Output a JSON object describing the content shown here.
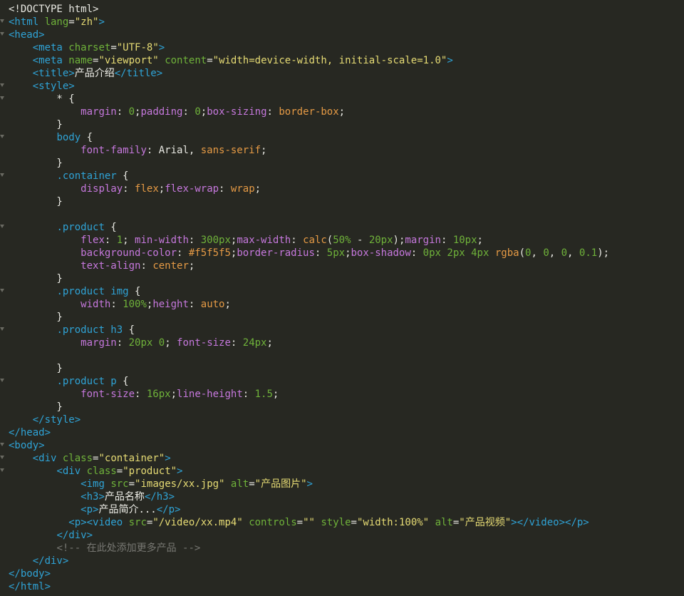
{
  "editor": {
    "colors": {
      "background": "#272822",
      "tag": "#2fa3d6",
      "attribute": "#6fb23a",
      "string": "#e6db74",
      "property": "#c678dd",
      "number": "#6fb23a",
      "value": "#e59a45",
      "comment": "#777772"
    },
    "lines": [
      {
        "fold": false,
        "tokens": [
          [
            "doctype",
            "<!DOCTYPE html>"
          ]
        ]
      },
      {
        "fold": true,
        "tokens": [
          [
            "tag",
            "<html "
          ],
          [
            "attr",
            "lang"
          ],
          [
            "punc",
            "="
          ],
          [
            "str",
            "\"zh\""
          ],
          [
            "tag",
            ">"
          ]
        ]
      },
      {
        "fold": true,
        "tokens": [
          [
            "tag",
            "<head>"
          ]
        ]
      },
      {
        "fold": false,
        "tokens": [
          [
            "punc",
            "    "
          ],
          [
            "tag",
            "<meta "
          ],
          [
            "attr",
            "charset"
          ],
          [
            "punc",
            "="
          ],
          [
            "str",
            "\"UTF-8\""
          ],
          [
            "tag",
            ">"
          ]
        ]
      },
      {
        "fold": false,
        "tokens": [
          [
            "punc",
            "    "
          ],
          [
            "tag",
            "<meta "
          ],
          [
            "attr",
            "name"
          ],
          [
            "punc",
            "="
          ],
          [
            "str",
            "\"viewport\""
          ],
          [
            "punc",
            " "
          ],
          [
            "attr",
            "content"
          ],
          [
            "punc",
            "="
          ],
          [
            "str",
            "\"width=device-width, initial-scale=1.0\""
          ],
          [
            "tag",
            ">"
          ]
        ]
      },
      {
        "fold": false,
        "tokens": [
          [
            "punc",
            "    "
          ],
          [
            "tag",
            "<title>"
          ],
          [
            "text",
            "产品介绍"
          ],
          [
            "tag",
            "</title>"
          ]
        ]
      },
      {
        "fold": true,
        "tokens": [
          [
            "punc",
            "    "
          ],
          [
            "tag",
            "<style>"
          ]
        ]
      },
      {
        "fold": true,
        "tokens": [
          [
            "punc",
            "        * {"
          ]
        ]
      },
      {
        "fold": false,
        "tokens": [
          [
            "punc",
            "            "
          ],
          [
            "prop",
            "margin"
          ],
          [
            "punc",
            ": "
          ],
          [
            "num",
            "0"
          ],
          [
            "punc",
            ";"
          ],
          [
            "prop",
            "padding"
          ],
          [
            "punc",
            ": "
          ],
          [
            "num",
            "0"
          ],
          [
            "punc",
            ";"
          ],
          [
            "prop",
            "box-sizing"
          ],
          [
            "punc",
            ": "
          ],
          [
            "val",
            "border-box"
          ],
          [
            "punc",
            ";"
          ]
        ]
      },
      {
        "fold": false,
        "tokens": [
          [
            "punc",
            "        }"
          ]
        ]
      },
      {
        "fold": true,
        "tokens": [
          [
            "punc",
            "        "
          ],
          [
            "sel",
            "body"
          ],
          [
            "punc",
            " {"
          ]
        ]
      },
      {
        "fold": false,
        "tokens": [
          [
            "punc",
            "            "
          ],
          [
            "prop",
            "font-family"
          ],
          [
            "punc",
            ": Arial, "
          ],
          [
            "val",
            "sans-serif"
          ],
          [
            "punc",
            ";"
          ]
        ]
      },
      {
        "fold": false,
        "tokens": [
          [
            "punc",
            "        }"
          ]
        ]
      },
      {
        "fold": true,
        "tokens": [
          [
            "punc",
            "        "
          ],
          [
            "sel",
            ".container"
          ],
          [
            "punc",
            " {"
          ]
        ]
      },
      {
        "fold": false,
        "tokens": [
          [
            "punc",
            "            "
          ],
          [
            "prop",
            "display"
          ],
          [
            "punc",
            ": "
          ],
          [
            "val",
            "flex"
          ],
          [
            "punc",
            ";"
          ],
          [
            "prop",
            "flex-wrap"
          ],
          [
            "punc",
            ": "
          ],
          [
            "val",
            "wrap"
          ],
          [
            "punc",
            ";"
          ]
        ]
      },
      {
        "fold": false,
        "tokens": [
          [
            "punc",
            "        }"
          ]
        ]
      },
      {
        "fold": false,
        "tokens": [
          [
            "punc",
            ""
          ]
        ]
      },
      {
        "fold": true,
        "tokens": [
          [
            "punc",
            "        "
          ],
          [
            "sel",
            ".product"
          ],
          [
            "punc",
            " {"
          ]
        ]
      },
      {
        "fold": false,
        "tokens": [
          [
            "punc",
            "            "
          ],
          [
            "prop",
            "flex"
          ],
          [
            "punc",
            ": "
          ],
          [
            "num",
            "1"
          ],
          [
            "punc",
            "; "
          ],
          [
            "prop",
            "min-width"
          ],
          [
            "punc",
            ": "
          ],
          [
            "num",
            "300px"
          ],
          [
            "punc",
            ";"
          ],
          [
            "prop",
            "max-width"
          ],
          [
            "punc",
            ": "
          ],
          [
            "val",
            "calc"
          ],
          [
            "punc",
            "("
          ],
          [
            "num",
            "50%"
          ],
          [
            "punc",
            " - "
          ],
          [
            "num",
            "20px"
          ],
          [
            "punc",
            ");"
          ],
          [
            "prop",
            "margin"
          ],
          [
            "punc",
            ": "
          ],
          [
            "num",
            "10px"
          ],
          [
            "punc",
            ";"
          ]
        ]
      },
      {
        "fold": false,
        "tokens": [
          [
            "punc",
            "            "
          ],
          [
            "prop",
            "background-color"
          ],
          [
            "punc",
            ": "
          ],
          [
            "val",
            "#f5f5f5"
          ],
          [
            "punc",
            ";"
          ],
          [
            "prop",
            "border-radius"
          ],
          [
            "punc",
            ": "
          ],
          [
            "num",
            "5px"
          ],
          [
            "punc",
            ";"
          ],
          [
            "prop",
            "box-shadow"
          ],
          [
            "punc",
            ": "
          ],
          [
            "num",
            "0px"
          ],
          [
            "punc",
            " "
          ],
          [
            "num",
            "2px"
          ],
          [
            "punc",
            " "
          ],
          [
            "num",
            "4px"
          ],
          [
            "punc",
            " "
          ],
          [
            "val",
            "rgba"
          ],
          [
            "punc",
            "("
          ],
          [
            "num",
            "0"
          ],
          [
            "punc",
            ", "
          ],
          [
            "num",
            "0"
          ],
          [
            "punc",
            ", "
          ],
          [
            "num",
            "0"
          ],
          [
            "punc",
            ", "
          ],
          [
            "num",
            "0.1"
          ],
          [
            "punc",
            ");"
          ]
        ]
      },
      {
        "fold": false,
        "tokens": [
          [
            "punc",
            "            "
          ],
          [
            "prop",
            "text-align"
          ],
          [
            "punc",
            ": "
          ],
          [
            "val",
            "center"
          ],
          [
            "punc",
            ";"
          ]
        ]
      },
      {
        "fold": false,
        "tokens": [
          [
            "punc",
            "        }"
          ]
        ]
      },
      {
        "fold": true,
        "tokens": [
          [
            "punc",
            "        "
          ],
          [
            "sel",
            ".product img"
          ],
          [
            "punc",
            " {"
          ]
        ]
      },
      {
        "fold": false,
        "tokens": [
          [
            "punc",
            "            "
          ],
          [
            "prop",
            "width"
          ],
          [
            "punc",
            ": "
          ],
          [
            "num",
            "100%"
          ],
          [
            "punc",
            ";"
          ],
          [
            "prop",
            "height"
          ],
          [
            "punc",
            ": "
          ],
          [
            "val",
            "auto"
          ],
          [
            "punc",
            ";"
          ]
        ]
      },
      {
        "fold": false,
        "tokens": [
          [
            "punc",
            "        }"
          ]
        ]
      },
      {
        "fold": true,
        "tokens": [
          [
            "punc",
            "        "
          ],
          [
            "sel",
            ".product h3"
          ],
          [
            "punc",
            " {"
          ]
        ]
      },
      {
        "fold": false,
        "tokens": [
          [
            "punc",
            "            "
          ],
          [
            "prop",
            "margin"
          ],
          [
            "punc",
            ": "
          ],
          [
            "num",
            "20px"
          ],
          [
            "punc",
            " "
          ],
          [
            "num",
            "0"
          ],
          [
            "punc",
            "; "
          ],
          [
            "prop",
            "font-size"
          ],
          [
            "punc",
            ": "
          ],
          [
            "num",
            "24px"
          ],
          [
            "punc",
            ";"
          ]
        ]
      },
      {
        "fold": false,
        "tokens": [
          [
            "punc",
            ""
          ]
        ]
      },
      {
        "fold": false,
        "tokens": [
          [
            "punc",
            "        }"
          ]
        ]
      },
      {
        "fold": true,
        "tokens": [
          [
            "punc",
            "        "
          ],
          [
            "sel",
            ".product p"
          ],
          [
            "punc",
            " {"
          ]
        ]
      },
      {
        "fold": false,
        "tokens": [
          [
            "punc",
            "            "
          ],
          [
            "prop",
            "font-size"
          ],
          [
            "punc",
            ": "
          ],
          [
            "num",
            "16px"
          ],
          [
            "punc",
            ";"
          ],
          [
            "prop",
            "line-height"
          ],
          [
            "punc",
            ": "
          ],
          [
            "num",
            "1.5"
          ],
          [
            "punc",
            ";"
          ]
        ]
      },
      {
        "fold": false,
        "tokens": [
          [
            "punc",
            "        }"
          ]
        ]
      },
      {
        "fold": false,
        "tokens": [
          [
            "punc",
            "    "
          ],
          [
            "tag",
            "</style>"
          ]
        ]
      },
      {
        "fold": false,
        "tokens": [
          [
            "tag",
            "</head>"
          ]
        ]
      },
      {
        "fold": true,
        "tokens": [
          [
            "tag",
            "<body>"
          ]
        ]
      },
      {
        "fold": true,
        "tokens": [
          [
            "punc",
            "    "
          ],
          [
            "tag",
            "<div "
          ],
          [
            "attr",
            "class"
          ],
          [
            "punc",
            "="
          ],
          [
            "str",
            "\"container\""
          ],
          [
            "tag",
            ">"
          ]
        ]
      },
      {
        "fold": true,
        "tokens": [
          [
            "punc",
            "        "
          ],
          [
            "tag",
            "<div "
          ],
          [
            "attr",
            "class"
          ],
          [
            "punc",
            "="
          ],
          [
            "str",
            "\"product\""
          ],
          [
            "tag",
            ">"
          ]
        ]
      },
      {
        "fold": false,
        "tokens": [
          [
            "punc",
            "            "
          ],
          [
            "tag",
            "<img "
          ],
          [
            "attr",
            "src"
          ],
          [
            "punc",
            "="
          ],
          [
            "str",
            "\"images/xx.jpg\""
          ],
          [
            "punc",
            " "
          ],
          [
            "attr",
            "alt"
          ],
          [
            "punc",
            "="
          ],
          [
            "str",
            "\"产品图片\""
          ],
          [
            "tag",
            ">"
          ]
        ]
      },
      {
        "fold": false,
        "tokens": [
          [
            "punc",
            "            "
          ],
          [
            "tag",
            "<h3>"
          ],
          [
            "text",
            "产品名称"
          ],
          [
            "tag",
            "</h3>"
          ]
        ]
      },
      {
        "fold": false,
        "tokens": [
          [
            "punc",
            "            "
          ],
          [
            "tag",
            "<p>"
          ],
          [
            "text",
            "产品简介..."
          ],
          [
            "tag",
            "</p>"
          ]
        ]
      },
      {
        "fold": false,
        "tokens": [
          [
            "punc",
            "          "
          ],
          [
            "tag",
            "<p><video "
          ],
          [
            "attr",
            "src"
          ],
          [
            "punc",
            "="
          ],
          [
            "str",
            "\"/video/xx.mp4\""
          ],
          [
            "punc",
            " "
          ],
          [
            "attr",
            "controls"
          ],
          [
            "punc",
            "="
          ],
          [
            "str",
            "\"\""
          ],
          [
            "punc",
            " "
          ],
          [
            "attr",
            "style"
          ],
          [
            "punc",
            "="
          ],
          [
            "str",
            "\"width:100%\""
          ],
          [
            "punc",
            " "
          ],
          [
            "attr",
            "alt"
          ],
          [
            "punc",
            "="
          ],
          [
            "str",
            "\"产品视频\""
          ],
          [
            "tag",
            "></video></p>"
          ]
        ]
      },
      {
        "fold": false,
        "tokens": [
          [
            "punc",
            "        "
          ],
          [
            "tag",
            "</div>"
          ]
        ]
      },
      {
        "fold": false,
        "tokens": [
          [
            "punc",
            "        "
          ],
          [
            "comment",
            "<!-- 在此处添加更多产品 -->"
          ]
        ]
      },
      {
        "fold": false,
        "tokens": [
          [
            "punc",
            "    "
          ],
          [
            "tag",
            "</div>"
          ]
        ]
      },
      {
        "fold": false,
        "tokens": [
          [
            "tag",
            "</body>"
          ]
        ]
      },
      {
        "fold": false,
        "tokens": [
          [
            "tag",
            "</html>"
          ]
        ]
      }
    ]
  }
}
